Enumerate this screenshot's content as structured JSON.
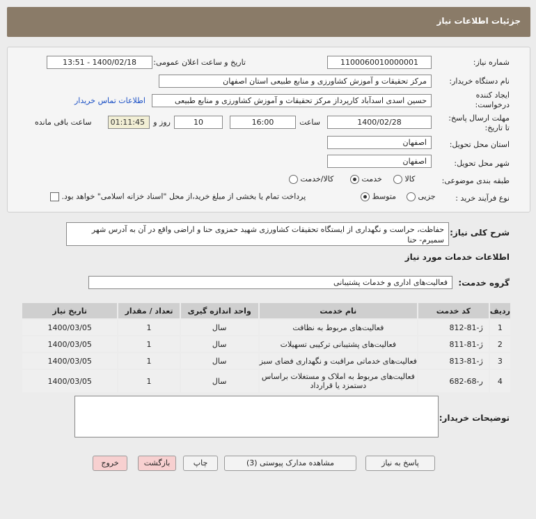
{
  "header": {
    "title": "جزئیات اطلاعات نیاز"
  },
  "fields": {
    "need_number_label": "شماره نیاز:",
    "need_number": "1100060010000001",
    "announce_label": "تاریخ و ساعت اعلان عمومی:",
    "announce_value": "1400/02/18 - 13:51",
    "buyer_org_label": "نام دستگاه خریدار:",
    "buyer_org": "مرکز تحقیقات و آموزش کشاورزی و منابع طبیعی استان اصفهان",
    "requester_label_1": "ایجاد کننده",
    "requester_label_2": "درخواست:",
    "requester": "حسین اسدی اسدآباد کارپرداز مرکز تحقیقات و آموزش کشاورزی و منابع طبیعی",
    "contact_link": "اطلاعات تماس خریدار",
    "deadline_label_1": "مهلت ارسال پاسخ:",
    "deadline_label_2": "تا تاریخ:",
    "deadline_date": "1400/02/28",
    "time_label": "ساعت",
    "deadline_time": "16:00",
    "days_value": "10",
    "days_label": "روز و",
    "remaining_time": "01:11:45",
    "remaining_label": "ساعت باقی مانده",
    "province_label": "استان محل تحویل:",
    "province": "اصفهان",
    "city_label": "شهر محل تحویل:",
    "city": "اصفهان",
    "category_label": "طبقه بندی موضوعی:",
    "category_options": [
      "کالا",
      "خدمت",
      "کالا/خدمت"
    ],
    "purchase_label": "نوع فرآیند خرید :",
    "purchase_options": [
      "جزیی",
      "متوسط"
    ],
    "payment_note": "پرداخت تمام یا بخشی از مبلغ خرید،از محل \"اسناد خزانه اسلامی\" خواهد بود."
  },
  "summary": {
    "label": "شرح کلی نیاز:",
    "text": "حفاظت، حراست و نگهداری از ایستگاه تحقیقات کشاورزی شهید حمزوی حنا و اراضی واقع در آن به آدرس شهر سمیرم- حنا"
  },
  "services": {
    "section_title": "اطلاعات خدمات مورد نیاز",
    "group_label": "گروه خدمت:",
    "group_value": "فعالیت‌های اداری و خدمات پشتیبانی",
    "columns": [
      "ردیف",
      "کد خدمت",
      "نام خدمت",
      "واحد اندازه گیری",
      "تعداد / مقدار",
      "تاریخ نیاز"
    ],
    "rows": [
      {
        "idx": "1",
        "code": "ژ-81-812",
        "name": "فعالیت‌های مربوط به نظافت",
        "unit": "سال",
        "qty": "1",
        "date": "1400/03/05"
      },
      {
        "idx": "2",
        "code": "ژ-81-811",
        "name": "فعالیت‌های پشتیبانی ترکیبی تسهیلات",
        "unit": "سال",
        "qty": "1",
        "date": "1400/03/05"
      },
      {
        "idx": "3",
        "code": "ژ-81-813",
        "name": "فعالیت‌های خدماتی مراقبت و نگهداری فضای سبز",
        "unit": "سال",
        "qty": "1",
        "date": "1400/03/05"
      },
      {
        "idx": "4",
        "code": "ر-68-682",
        "name": "فعالیت‌های مربوط به املاک و مستغلات براساس دستمزد یا قرارداد",
        "unit": "سال",
        "qty": "1",
        "date": "1400/03/05"
      }
    ]
  },
  "buyer_notes": {
    "label": "توضیحات خریدار:",
    "value": ""
  },
  "buttons": {
    "reply": "پاسخ به نیاز",
    "attachments": "مشاهده مدارک پیوستی (3)",
    "print": "چاپ",
    "back": "بازگشت",
    "exit": "خروج"
  }
}
